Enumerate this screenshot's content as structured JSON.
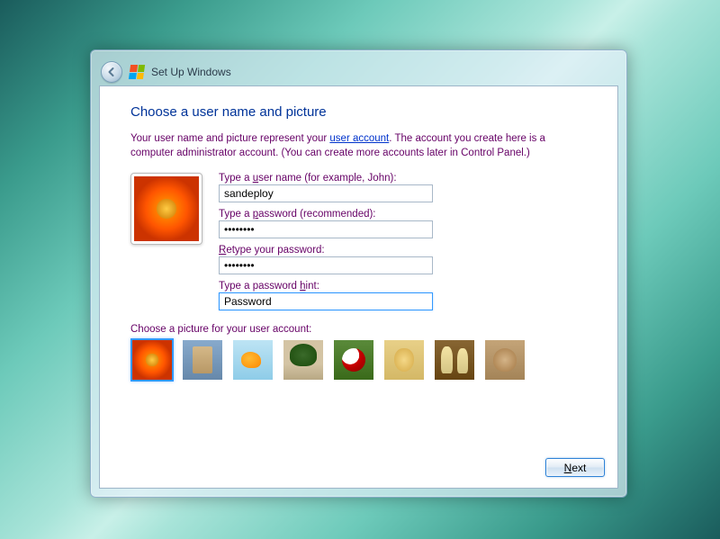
{
  "window": {
    "title": "Set Up Windows"
  },
  "heading": "Choose a user name and picture",
  "intro": {
    "prefix": "Your user name and picture represent your ",
    "link": "user account",
    "suffix": ". The account you create here is a computer administrator account. (You can create more accounts later in Control Panel.)"
  },
  "fields": {
    "username_label": "Type a user name (for example, John):",
    "username_value": "sandeploy",
    "password_label": "Type a password (recommended):",
    "password_value": "••••••••",
    "retype_label": "Retype your password:",
    "retype_value": "••••••••",
    "hint_label": "Type a password hint:",
    "hint_value": "Password"
  },
  "picture_section": {
    "label": "Choose a picture for your user account:",
    "selected_index": 0,
    "options": [
      {
        "name": "flower"
      },
      {
        "name": "robot"
      },
      {
        "name": "goldfish"
      },
      {
        "name": "bonsai"
      },
      {
        "name": "soccer-ball"
      },
      {
        "name": "puppy"
      },
      {
        "name": "chess"
      },
      {
        "name": "kitten"
      }
    ]
  },
  "buttons": {
    "next": "Next"
  }
}
